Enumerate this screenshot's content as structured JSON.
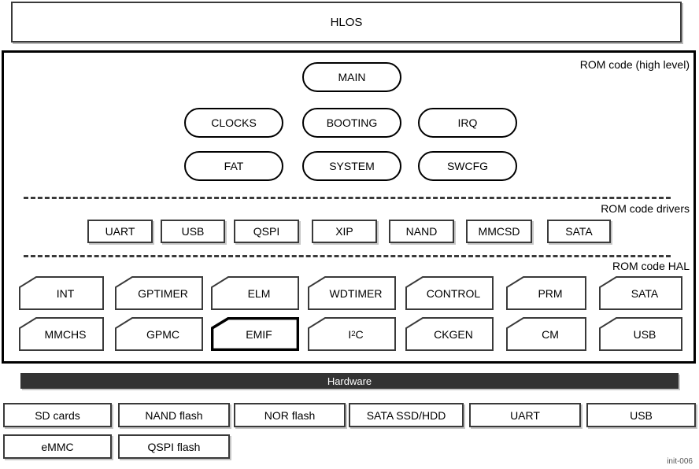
{
  "hlos": {
    "label": "HLOS"
  },
  "rom_code": {
    "high_level_caption": "ROM code (high level)",
    "drivers_caption": "ROM code drivers",
    "hal_caption": "ROM code HAL",
    "high_level_modules": [
      {
        "label": "MAIN",
        "row": 0,
        "col": 1
      },
      {
        "label": "CLOCKS",
        "row": 1,
        "col": 0
      },
      {
        "label": "BOOTING",
        "row": 1,
        "col": 1
      },
      {
        "label": "IRQ",
        "row": 1,
        "col": 2
      },
      {
        "label": "FAT",
        "row": 2,
        "col": 0
      },
      {
        "label": "SYSTEM",
        "row": 2,
        "col": 1
      },
      {
        "label": "SWCFG",
        "row": 2,
        "col": 2
      }
    ],
    "drivers": [
      {
        "label": "UART"
      },
      {
        "label": "USB"
      },
      {
        "label": "QSPI"
      },
      {
        "label": "XIP"
      },
      {
        "label": "NAND"
      },
      {
        "label": "MMCSD"
      },
      {
        "label": "SATA"
      }
    ],
    "hal_row_1": [
      {
        "label": "INT",
        "emphasis": false
      },
      {
        "label": "GPTIMER",
        "emphasis": false
      },
      {
        "label": "ELM",
        "emphasis": false
      },
      {
        "label": "WDTIMER",
        "emphasis": false
      },
      {
        "label": "CONTROL",
        "emphasis": false
      },
      {
        "label": "PRM",
        "emphasis": false
      },
      {
        "label": "SATA",
        "emphasis": false
      }
    ],
    "hal_row_2": [
      {
        "label": "MMCHS",
        "emphasis": false
      },
      {
        "label": "GPMC",
        "emphasis": false
      },
      {
        "label": "EMIF",
        "emphasis": true
      },
      {
        "label": "I2C",
        "emphasis": false,
        "html": "I<sup>2</sup>C"
      },
      {
        "label": "CKGEN",
        "emphasis": false
      },
      {
        "label": "CM",
        "emphasis": false
      },
      {
        "label": "USB",
        "emphasis": false
      }
    ]
  },
  "hardware": {
    "bar_label": "Hardware",
    "row_1": [
      {
        "label": "SD cards"
      },
      {
        "label": "NAND flash"
      },
      {
        "label": "NOR flash"
      },
      {
        "label": "SATA SSD/HDD"
      },
      {
        "label": "UART"
      },
      {
        "label": "USB"
      }
    ],
    "row_2": [
      {
        "label": "eMMC"
      },
      {
        "label": "QSPI flash"
      }
    ]
  },
  "figure_caption": "init-006",
  "colors": {
    "hardware_bar": "#333333",
    "box_border": "#3a3a3a",
    "container_border": "#000000",
    "shadow": "#c6c6c6",
    "background": "#ffffff"
  }
}
